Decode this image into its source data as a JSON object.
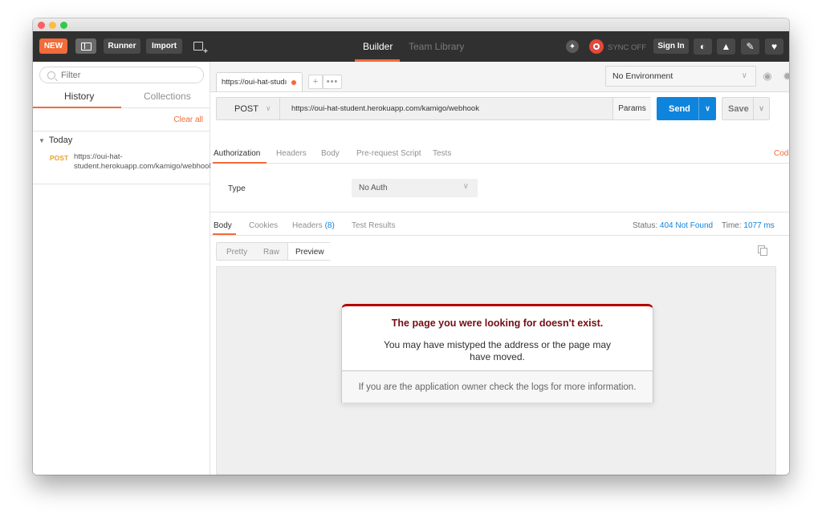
{
  "toolbar": {
    "new_label": "NEW",
    "runner_label": "Runner",
    "import_label": "Import",
    "tabs": [
      "Builder",
      "Team Library"
    ],
    "sync_text": "SYNC OFF",
    "signin_label": "Sign In",
    "accent": "#f26b3a"
  },
  "sidebar": {
    "filter_placeholder": "Filter",
    "tabs": [
      "History",
      "Collections"
    ],
    "clear_all": "Clear all",
    "group_label": "Today",
    "items": [
      {
        "method": "POST",
        "url": "https://oui-hat-student.herokuapp.com/kamigo/webhook"
      }
    ]
  },
  "request": {
    "tab_title": "https://oui-hat-studı",
    "environment": "No Environment",
    "method": "POST",
    "url": "https://oui-hat-student.herokuapp.com/kamigo/webhook",
    "params_label": "Params",
    "send_label": "Send",
    "save_label": "Save",
    "sub_tabs": [
      "Authorization",
      "Headers",
      "Body",
      "Pre-request Script",
      "Tests"
    ],
    "code_label": "Code",
    "auth_type_label": "Type",
    "auth_type_value": "No Auth"
  },
  "response": {
    "tabs": [
      "Body",
      "Cookies",
      "Headers",
      "Test Results"
    ],
    "headers_count": "(8)",
    "status_label": "Status:",
    "status_value": "404 Not Found",
    "time_label": "Time:",
    "time_value": "1077 ms",
    "view_tabs": [
      "Pretty",
      "Raw",
      "Preview"
    ],
    "status_color": "#0f84dc"
  },
  "preview": {
    "title": "The page you were looking for doesn't exist.",
    "message": "You may have mistyped the address or the page may have moved.",
    "footer": "If you are the application owner check the logs for more information."
  }
}
